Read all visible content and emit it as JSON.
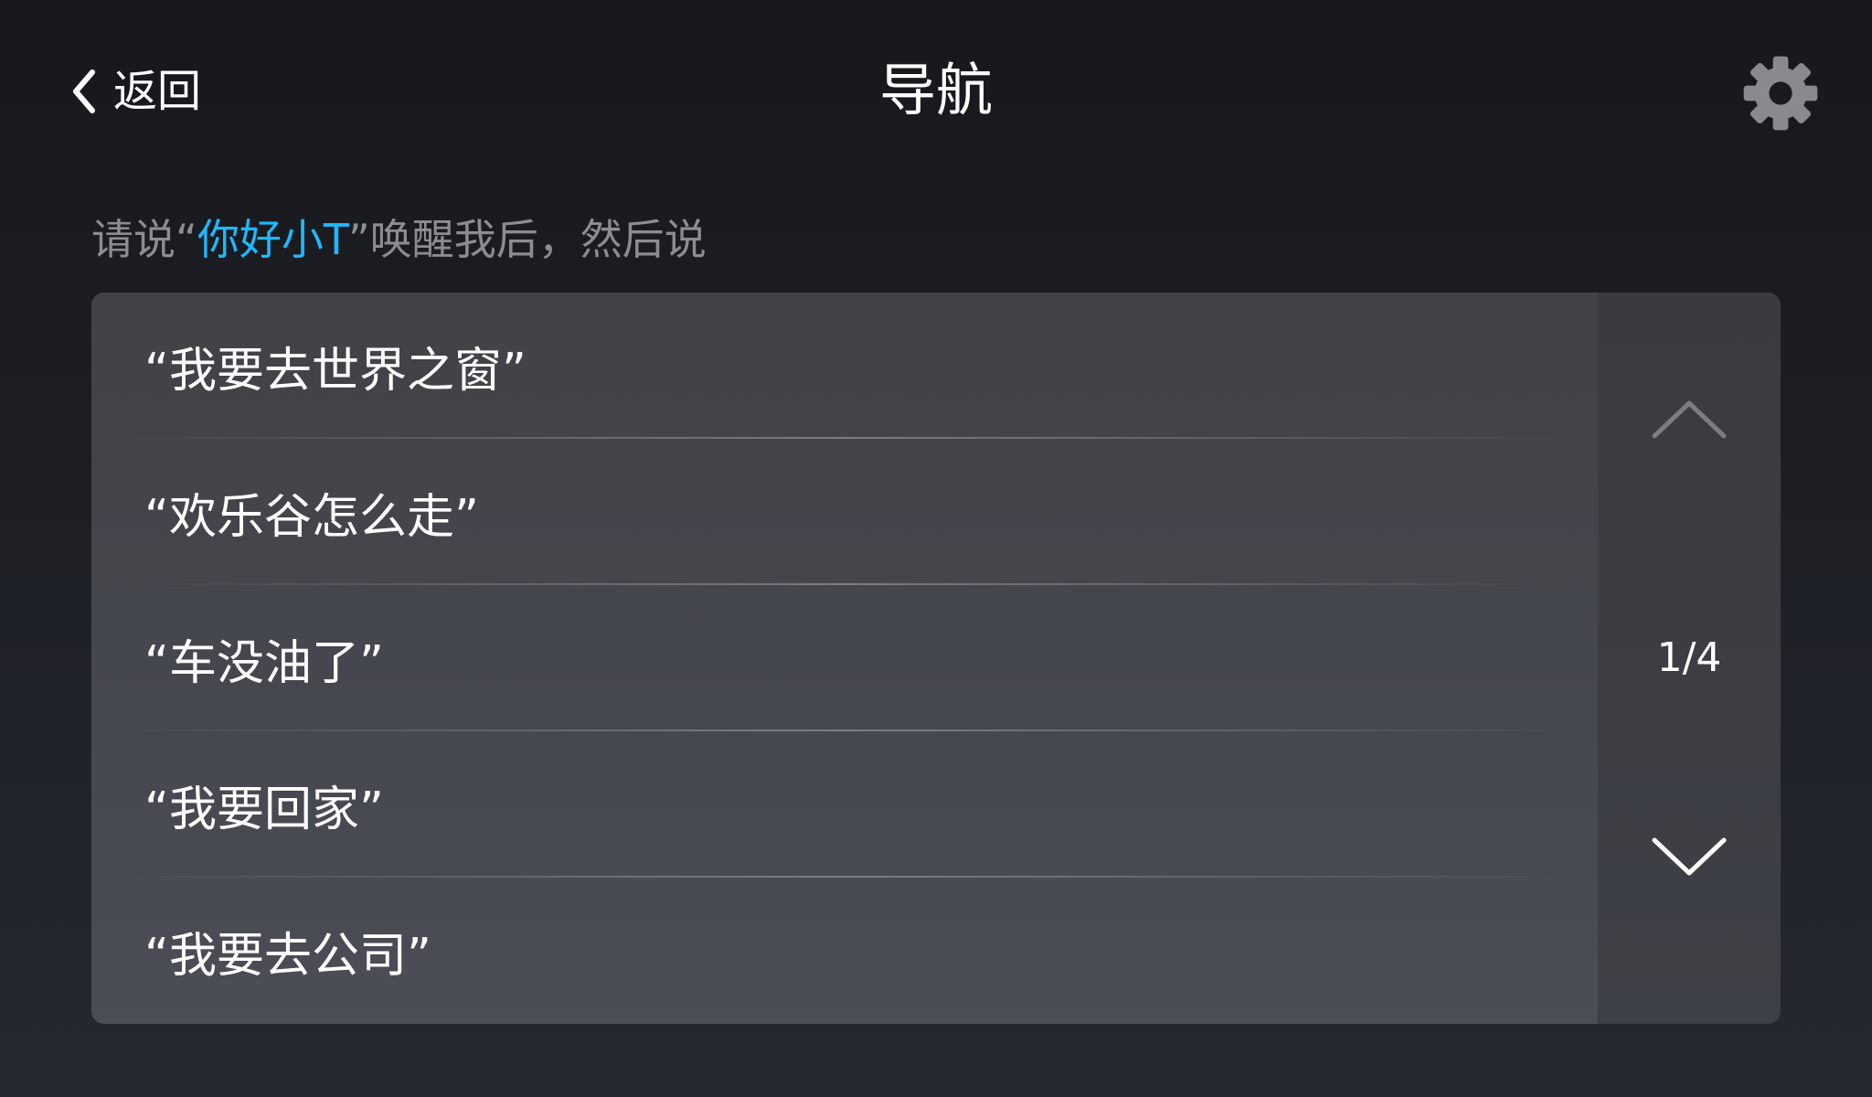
{
  "header": {
    "back_label": "返回",
    "title": "导航",
    "back_icon": "chevron-left-icon",
    "settings_icon": "gear-icon"
  },
  "prompt": {
    "before": "请说“",
    "wake_word": "你好小T",
    "after": "”唤醒我后，然后说",
    "wake_color": "#1fb8ff"
  },
  "commands": [
    {
      "text": "“我要去世界之窗”"
    },
    {
      "text": "“欢乐谷怎么走”"
    },
    {
      "text": "“车没油了”"
    },
    {
      "text": "“我要回家”"
    },
    {
      "text": "“我要去公司”"
    }
  ],
  "pager": {
    "indicator": "1/4",
    "up_icon": "chevron-up-icon",
    "down_icon": "chevron-down-icon"
  }
}
